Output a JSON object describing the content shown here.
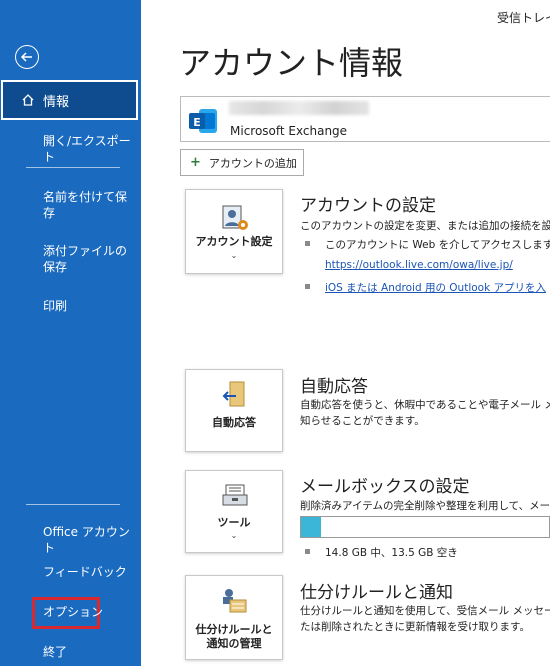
{
  "topbar": {
    "folder": "受信トレイ"
  },
  "sidebar": {
    "active": "情報",
    "items": [
      {
        "label": "開く/エクスポート"
      },
      {
        "label": "名前を付けて保存"
      },
      {
        "label": "添付ファイルの保存"
      },
      {
        "label": "印刷"
      },
      {
        "label": "Office アカウント"
      },
      {
        "label": "フィードバック"
      },
      {
        "label": "オプション"
      },
      {
        "label": "終了"
      }
    ]
  },
  "main": {
    "title": "アカウント情報",
    "account": {
      "type": "Microsoft Exchange",
      "add_label": "アカウントの追加"
    },
    "account_settings": {
      "tile_label": "アカウント設定",
      "title": "アカウントの設定",
      "desc": "このアカウントの設定を変更、または追加の接続を設定",
      "bullet1": "このアカウントに Web を介してアクセスします。",
      "link1": "https://outlook.live.com/owa/live.jp/",
      "link2": "iOS または Android 用の Outlook アプリを入"
    },
    "auto_reply": {
      "tile_label": "自動応答",
      "title": "自動応答",
      "desc1": "自動応答を使うと、休暇中であることや電子メール メ",
      "desc2": "知らせることができます。"
    },
    "mailbox": {
      "tile_label": "ツール",
      "title": "メールボックスの設定",
      "desc": "削除済みアイテムの完全削除や整理を利用して、メー",
      "progress": 0.08,
      "usage": "14.8 GB 中、13.5 GB 空き"
    },
    "rules": {
      "tile_label1": "仕分けルールと",
      "tile_label2": "通知の管理",
      "title": "仕分けルールと通知",
      "desc1": "仕分けルールと通知を使用して、受信メール メッセージ",
      "desc2": "たは削除されたときに更新情報を受け取ります。"
    }
  },
  "colors": {
    "sidebar": "#1a6ac0",
    "sidebar_active": "#0f4c8f",
    "highlight": "#d9282f",
    "link": "#1a55b5",
    "progress": "#3cb6d8"
  }
}
